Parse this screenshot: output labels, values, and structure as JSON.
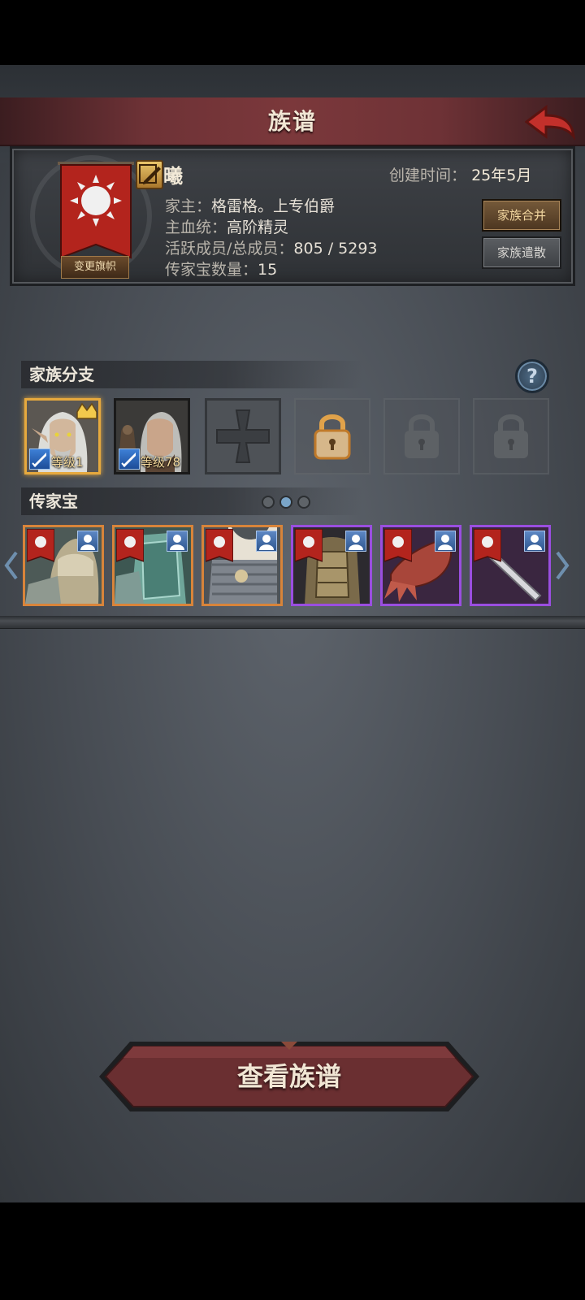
{
  "header": {
    "title": "族谱"
  },
  "family": {
    "name": "曦",
    "change_flag_label": "变更旗帜",
    "created_label": "创建时间：",
    "created_value": "25年5月",
    "head_label": "家主：",
    "head_value": "格雷格。上专伯爵",
    "bloodline_label": "主血统：",
    "bloodline_value": "高阶精灵",
    "members_label": "活跃成员/总成员：",
    "members_value": "805 / 5293",
    "heirloom_count_label": "传家宝数量：",
    "heirloom_count_value": "15",
    "merge_button": "家族合并",
    "disband_button": "家族遣散"
  },
  "branches": {
    "title": "家族分支",
    "help_label": "?",
    "heroes": [
      {
        "level": "等级1",
        "selected": true
      },
      {
        "level": "等级78",
        "selected": false
      }
    ]
  },
  "heirlooms": {
    "title": "传家宝",
    "page_count": 3,
    "active_page": 1,
    "items": [
      {
        "rarity": "orange",
        "icon": "armor-helmet-icon"
      },
      {
        "rarity": "orange",
        "icon": "teal-armor-icon"
      },
      {
        "rarity": "orange",
        "icon": "chainmail-icon"
      },
      {
        "rarity": "purple",
        "icon": "leather-armor-icon"
      },
      {
        "rarity": "purple",
        "icon": "red-claw-icon"
      },
      {
        "rarity": "purple",
        "icon": "sword-icon"
      }
    ]
  },
  "view_button": "查看族谱",
  "colors": {
    "header": "#7b383b",
    "orange_rarity": "#d8843a",
    "purple_rarity": "#9a4ee0",
    "gold": "#e6a93e"
  }
}
